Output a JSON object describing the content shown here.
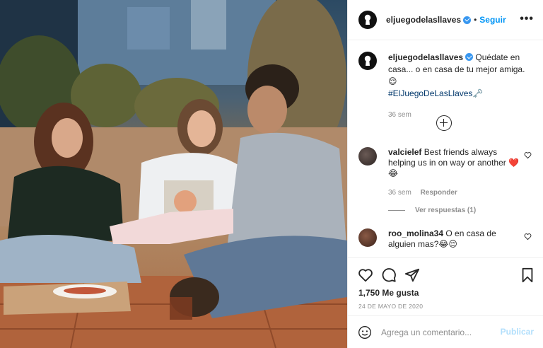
{
  "post": {
    "username": "eljuegodelasllaves",
    "follow_label": "Seguir",
    "more_label": "•••",
    "separator": "•"
  },
  "caption": {
    "username": "eljuegodelasllaves",
    "text": "Quédate en casa... o en casa de tu mejor amiga. 😌",
    "hashtag": "#ElJuegoDeLasLlaves",
    "emoji_end": "🗝️",
    "time": "36 sem"
  },
  "comments": [
    {
      "username": "valcielef",
      "text": "Best friends always helping us in on way or another ❤️ 😂",
      "time": "36 sem",
      "reply_label": "Responder",
      "view_replies": "Ver respuestas (1)"
    },
    {
      "username": "roo_molina34",
      "text": "O en casa de alguien mas?😂😌"
    }
  ],
  "engagement": {
    "likes": "1,750 Me gusta",
    "date": "24 DE MAYO DE 2020"
  },
  "composer": {
    "placeholder": "Agrega un comentario...",
    "publish_label": "Publicar"
  },
  "colors": {
    "accent": "#0095f6",
    "verified": "#3897f0",
    "muted": "#8e8e8e",
    "heart": "#ed4956"
  },
  "icons": [
    "keyhole-icon",
    "verified-icon",
    "more-icon",
    "load-more-icon",
    "heart-icon",
    "comment-icon",
    "share-icon",
    "save-icon",
    "emoji-icon"
  ]
}
